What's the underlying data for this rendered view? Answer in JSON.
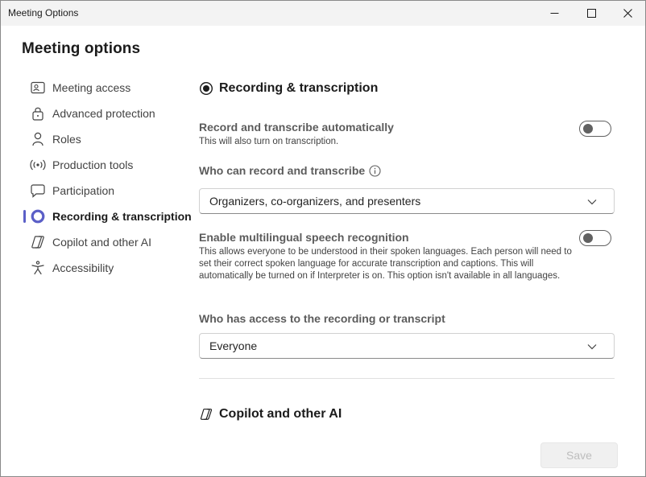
{
  "window": {
    "title": "Meeting Options"
  },
  "page": {
    "title": "Meeting options"
  },
  "nav": {
    "items": [
      {
        "label": "Meeting access",
        "icon": "person-badge-icon"
      },
      {
        "label": "Advanced protection",
        "icon": "lock-icon"
      },
      {
        "label": "Roles",
        "icon": "person-icon"
      },
      {
        "label": "Production tools",
        "icon": "broadcast-icon"
      },
      {
        "label": "Participation",
        "icon": "chat-icon"
      },
      {
        "label": "Recording & transcription",
        "icon": "record-icon",
        "active": true
      },
      {
        "label": "Copilot and other AI",
        "icon": "copilot-icon"
      },
      {
        "label": "Accessibility",
        "icon": "accessibility-icon"
      }
    ]
  },
  "recording": {
    "title": "Recording & transcription",
    "auto_record": {
      "title": "Record and transcribe automatically",
      "desc": "This will also turn on transcription.",
      "on": false
    },
    "who_can_record": {
      "label": "Who can record and transcribe",
      "value": "Organizers, co-organizers, and presenters"
    },
    "multilingual": {
      "title": "Enable multilingual speech recognition",
      "desc": "This allows everyone to be understood in their spoken languages. Each person will need to set their correct spoken language for accurate transcription and captions. This will automatically be turned on if Interpreter is on. This option isn't available in all languages.",
      "on": false
    },
    "access": {
      "label": "Who has access to the recording or transcript",
      "value": "Everyone"
    }
  },
  "copilot": {
    "title": "Copilot and other AI"
  },
  "footer": {
    "save_label": "Save"
  },
  "colors": {
    "accent": "#5b5fc7",
    "text": "#242424",
    "muted": "#5c5c5c"
  }
}
